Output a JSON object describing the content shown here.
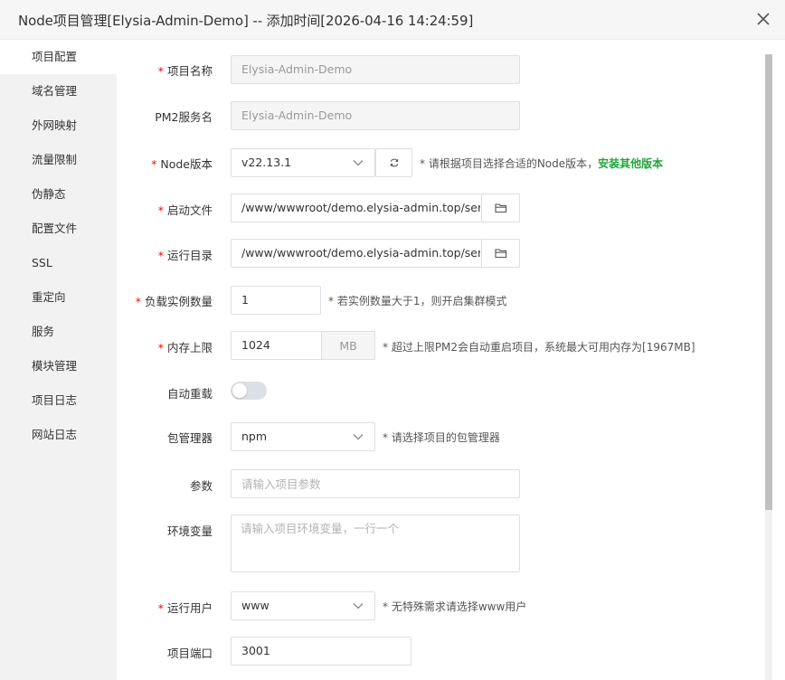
{
  "dialog": {
    "title": "Node项目管理[Elysia-Admin-Demo] -- 添加时间[2026-04-16 14:24:59]"
  },
  "sidebar": {
    "items": [
      {
        "label": "项目配置",
        "active": true
      },
      {
        "label": "域名管理"
      },
      {
        "label": "外网映射"
      },
      {
        "label": "流量限制"
      },
      {
        "label": "伪静态"
      },
      {
        "label": "配置文件"
      },
      {
        "label": "SSL"
      },
      {
        "label": "重定向"
      },
      {
        "label": "服务"
      },
      {
        "label": "模块管理"
      },
      {
        "label": "项目日志"
      },
      {
        "label": "网站日志"
      }
    ]
  },
  "form": {
    "required_mark": "*",
    "project_name": {
      "label": "项目名称",
      "value": "Elysia-Admin-Demo"
    },
    "pm2_name": {
      "label": "PM2服务名",
      "value": "Elysia-Admin-Demo"
    },
    "node_version": {
      "label": "Node版本",
      "value": "v22.13.1",
      "hint": "* 请根据项目选择合适的Node版本，",
      "hint_link": "安装其他版本"
    },
    "start_file": {
      "label": "启动文件",
      "value": "/www/wwwroot/demo.elysia-admin.top/serv"
    },
    "run_dir": {
      "label": "运行目录",
      "value": "/www/wwwroot/demo.elysia-admin.top/serv"
    },
    "instances": {
      "label": "负载实例数量",
      "value": "1",
      "hint": "* 若实例数量大于1，则开启集群模式"
    },
    "memory": {
      "label": "内存上限",
      "value": "1024",
      "unit": "MB",
      "hint": "* 超过上限PM2会自动重启项目，系统最大可用内存为[1967MB]"
    },
    "auto_reload": {
      "label": "自动重载",
      "enabled": false
    },
    "package_manager": {
      "label": "包管理器",
      "value": "npm",
      "hint": "* 请选择项目的包管理器"
    },
    "params": {
      "label": "参数",
      "placeholder": "请输入项目参数"
    },
    "env": {
      "label": "环境变量",
      "placeholder": "请输入项目环境变量，一行一个"
    },
    "run_user": {
      "label": "运行用户",
      "value": "www",
      "hint": "* 无特殊需求请选择www用户"
    },
    "port": {
      "label": "项目端口",
      "value": "3001"
    }
  },
  "icons": {
    "close": "close-icon",
    "refresh": "refresh-icon",
    "folder": "folder-icon",
    "chevron": "chevron-down-icon"
  },
  "colors": {
    "required": "#ef0808",
    "link": "#20a53a",
    "sidebar_bg": "#f2f2f2"
  }
}
